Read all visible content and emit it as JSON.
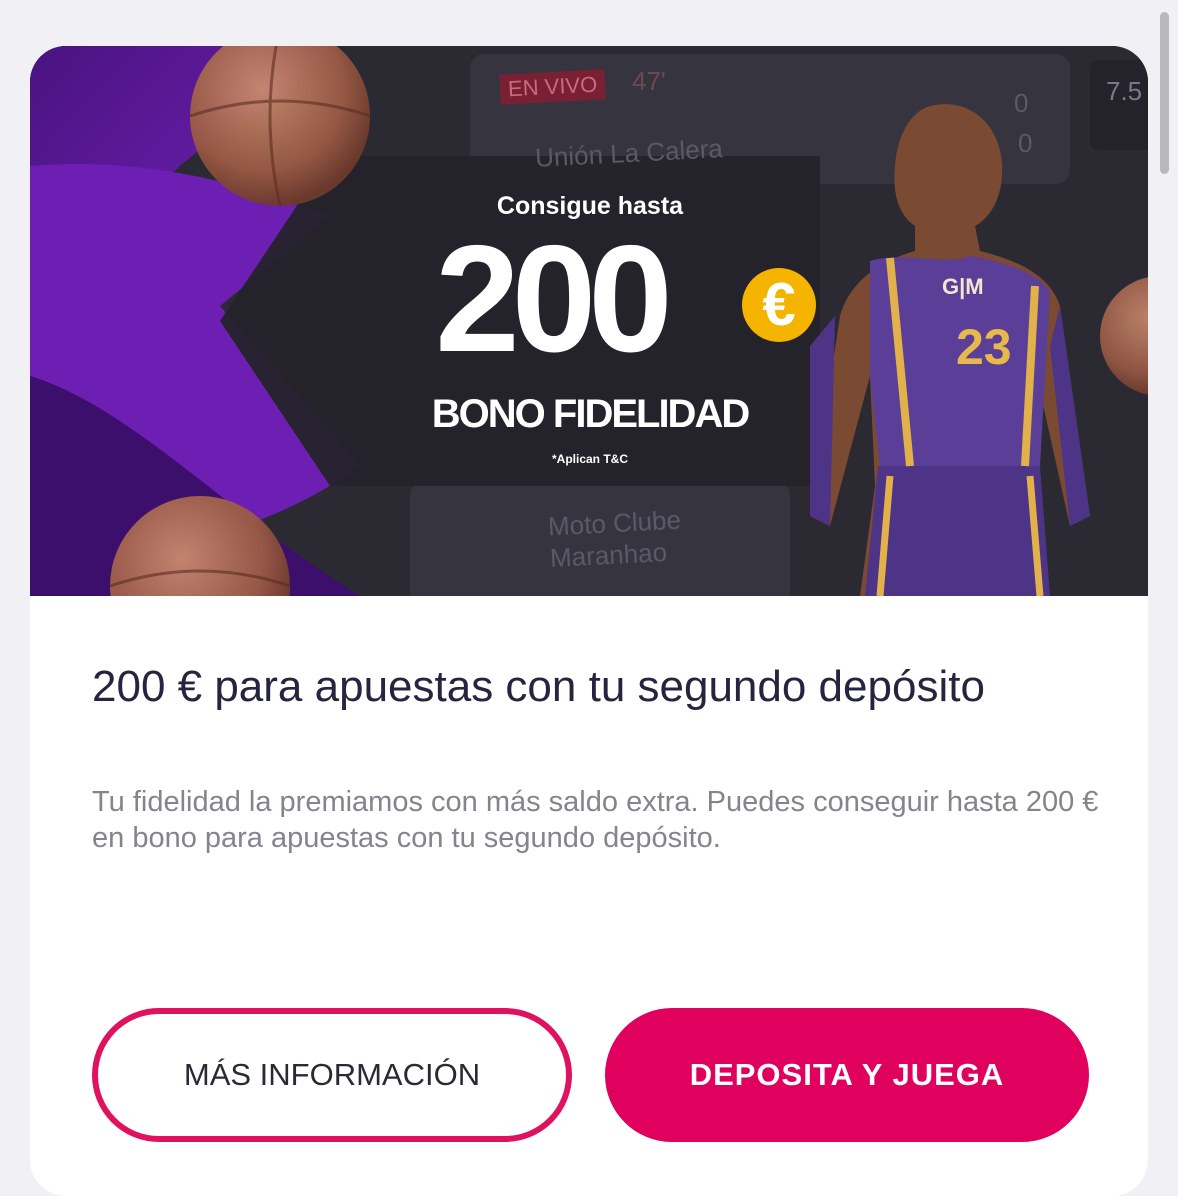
{
  "banner": {
    "intro": "Consigue hasta",
    "amount": "200",
    "currency": "€",
    "bonus_name": "BONO FIDELIDAD",
    "terms": "*Aplican T&C",
    "jersey_logo": "G|M",
    "jersey_number": "23",
    "background_texts": {
      "live_badge": "EN VIVO",
      "minute": "47'",
      "team_a": "Unión La Calera",
      "team_b_line1": "Moto Clube",
      "team_b_line2": "Maranhao",
      "score_a": "0",
      "score_b": "0",
      "odds": "7.5"
    }
  },
  "offer": {
    "title": "200 € para apuestas con tu segundo depósito",
    "description": "Tu fidelidad la premiamos con más saldo extra. Puedes conseguir hasta 200 € en bono para apuestas con tu segundo depósito."
  },
  "actions": {
    "info_label": "MÁS INFORMACIÓN",
    "deposit_label": "DEPOSITA Y JUEGA"
  },
  "colors": {
    "accent": "#e0005e",
    "banner_purple": "#5a1a9e",
    "title_text": "#262540",
    "description_text": "#85848e"
  }
}
